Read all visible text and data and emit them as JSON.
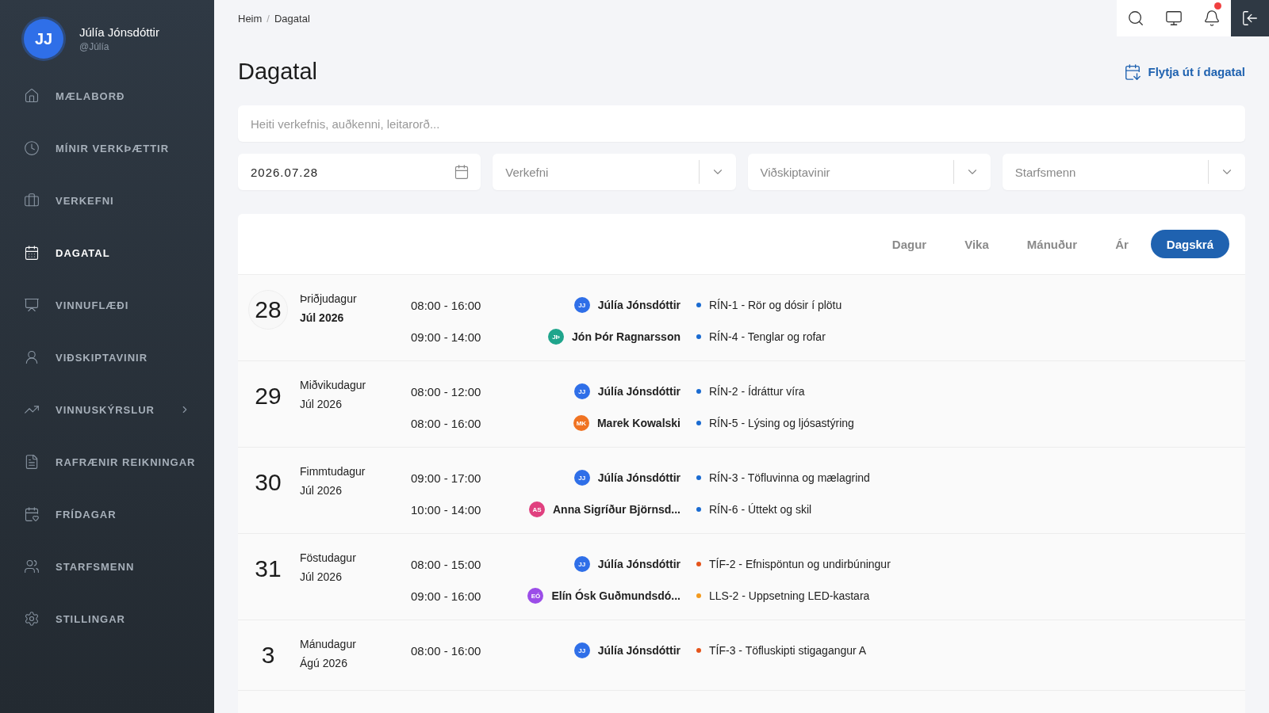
{
  "user": {
    "initials": "JJ",
    "name": "Júlía Jónsdóttir",
    "handle": "@Júlía"
  },
  "sidebar": {
    "items": [
      {
        "label": "MÆLABORÐ",
        "selected": false,
        "expandable": false
      },
      {
        "label": "MÍNIR VERKÞÆTTIR",
        "selected": false,
        "expandable": false
      },
      {
        "label": "VERKEFNI",
        "selected": false,
        "expandable": false
      },
      {
        "label": "DAGATAL",
        "selected": true,
        "expandable": false
      },
      {
        "label": "VINNUFLÆÐI",
        "selected": false,
        "expandable": false
      },
      {
        "label": "VIÐSKIPTAVINIR",
        "selected": false,
        "expandable": false
      },
      {
        "label": "VINNUSKÝRSLUR",
        "selected": false,
        "expandable": true
      },
      {
        "label": "RAFRÆNIR REIKNINGAR",
        "selected": false,
        "expandable": false
      },
      {
        "label": "FRÍDAGAR",
        "selected": false,
        "expandable": false
      },
      {
        "label": "STARFSMENN",
        "selected": false,
        "expandable": false
      },
      {
        "label": "STILLINGAR",
        "selected": false,
        "expandable": false
      }
    ]
  },
  "breadcrumb": {
    "separator": "/",
    "items": [
      "Heim",
      "Dagatal"
    ]
  },
  "topbar": {
    "notification": true
  },
  "title": "Dagatal",
  "export_link": "Flytja út í dagatal",
  "search": {
    "placeholder": "Heiti verkefnis, auðkenni, leitarorð..."
  },
  "filters": {
    "date": "2026.07.28",
    "selects": [
      {
        "placeholder": "Verkefni"
      },
      {
        "placeholder": "Viðskiptavinir"
      },
      {
        "placeholder": "Starfsmenn"
      }
    ]
  },
  "views": [
    {
      "label": "Dagur",
      "selected": false
    },
    {
      "label": "Vika",
      "selected": false
    },
    {
      "label": "Mánuður",
      "selected": false
    },
    {
      "label": "Ár",
      "selected": false
    },
    {
      "label": "Dagskrá",
      "selected": true
    }
  ],
  "days": [
    {
      "day": "28",
      "weekday": "Þriðjudagur",
      "month": "Júl 2026",
      "today": true,
      "events": [
        {
          "time": "08:00 - 16:00",
          "avatar": {
            "initials": "JJ",
            "color": "#2f6fe8"
          },
          "person": "Júlía Jónsdóttir",
          "task": "RÍN-1 - Rör og dósir í plötu",
          "color": "#1a6bd1"
        },
        {
          "time": "09:00 - 14:00",
          "avatar": {
            "initials": "JÞ",
            "color": "#1fa58c"
          },
          "person": "Jón Þór Ragnarsson",
          "task": "RÍN-4 - Tenglar og rofar",
          "color": "#1a6bd1"
        }
      ]
    },
    {
      "day": "29",
      "weekday": "Miðvikudagur",
      "month": "Júl 2026",
      "today": false,
      "events": [
        {
          "time": "08:00 - 12:00",
          "avatar": {
            "initials": "JJ",
            "color": "#2f6fe8"
          },
          "person": "Júlía Jónsdóttir",
          "task": "RÍN-2 - Ídráttur víra",
          "color": "#1a6bd1"
        },
        {
          "time": "08:00 - 16:00",
          "avatar": {
            "initials": "MK",
            "color": "#f07322"
          },
          "person": "Marek Kowalski",
          "task": "RÍN-5 - Lýsing og ljósastýring",
          "color": "#1a6bd1"
        }
      ]
    },
    {
      "day": "30",
      "weekday": "Fimmtudagur",
      "month": "Júl 2026",
      "today": false,
      "events": [
        {
          "time": "09:00 - 17:00",
          "avatar": {
            "initials": "JJ",
            "color": "#2f6fe8"
          },
          "person": "Júlía Jónsdóttir",
          "task": "RÍN-3 - Töfluvinna og mælagrind",
          "color": "#1a6bd1"
        },
        {
          "time": "10:00 - 14:00",
          "avatar": {
            "initials": "AS",
            "color": "#e0407f"
          },
          "person": "Anna Sigríður Björnsd...",
          "task": "RÍN-6 - Úttekt og skil",
          "color": "#1a6bd1"
        }
      ]
    },
    {
      "day": "31",
      "weekday": "Föstudagur",
      "month": "Júl 2026",
      "today": false,
      "events": [
        {
          "time": "08:00 - 15:00",
          "avatar": {
            "initials": "JJ",
            "color": "#2f6fe8"
          },
          "person": "Júlía Jónsdóttir",
          "task": "TÍF-2 - Efnispöntun og undirbúningur",
          "color": "#e5541b"
        },
        {
          "time": "09:00 - 16:00",
          "avatar": {
            "initials": "EÓ",
            "color": "#9b4de8"
          },
          "person": "Elín Ósk Guðmundsdó...",
          "task": "LLS-2 - Uppsetning LED-kastara",
          "color": "#f39a1e"
        }
      ]
    },
    {
      "day": "3",
      "weekday": "Mánudagur",
      "month": "Ágú 2026",
      "today": false,
      "events": [
        {
          "time": "08:00 - 16:00",
          "avatar": {
            "initials": "JJ",
            "color": "#2f6fe8"
          },
          "person": "Júlía Jónsdóttir",
          "task": "TÍF-3 - Töfluskipti stigagangur A",
          "color": "#e5541b"
        }
      ]
    }
  ]
}
